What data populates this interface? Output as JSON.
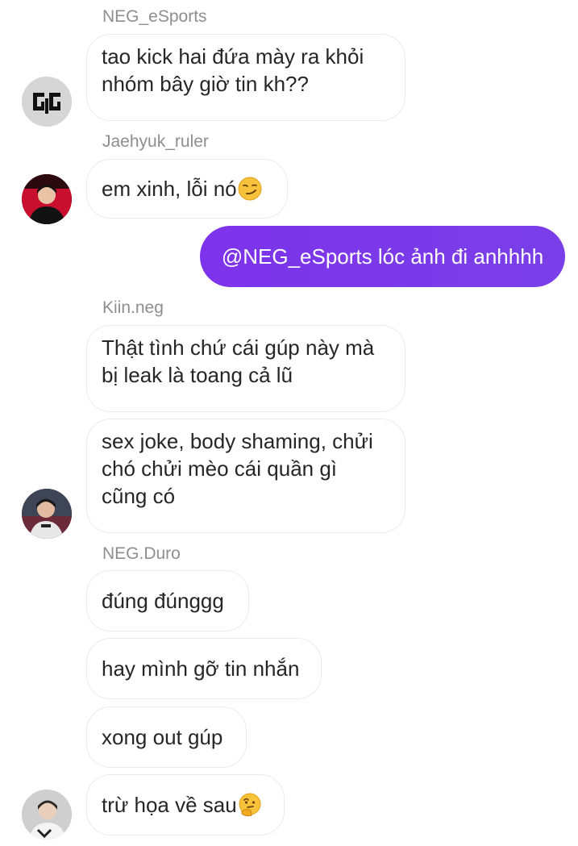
{
  "messages": {
    "sender_1": "NEG_eSports",
    "msg_1_line1": "tao kick hai đứa mày ra khỏi",
    "msg_1_line2": "nhóm bây giờ tin kh??",
    "sender_2": "Jaehyuk_ruler",
    "msg_2": "em xinh, lỗi nó",
    "msg_2_emoji": "smirking-face",
    "my_msg": "@NEG_eSports lóc ảnh đi anhhhh",
    "sender_3": "Kiin.neg",
    "msg_3_line1": "Thật tình chứ cái gúp này mà",
    "msg_3_line2": "bị leak là toang cả lũ",
    "msg_4_line1": "sex joke, body shaming, chửi",
    "msg_4_line2": "chó chửi mèo cái quần gì",
    "msg_4_line3": "cũng có",
    "sender_4": "NEG.Duro",
    "msg_5": "đúng đúnggg",
    "msg_6": "hay mình gỡ tin nhắn",
    "msg_7": "xong out gúp",
    "msg_8": "trừ họa về sau",
    "msg_8_emoji": "thinking-face"
  },
  "colors": {
    "my_bubble": "#7a36ea",
    "sender_name": "#8e8e8e",
    "bubble_border": "#ebebeb",
    "text": "#262626"
  }
}
